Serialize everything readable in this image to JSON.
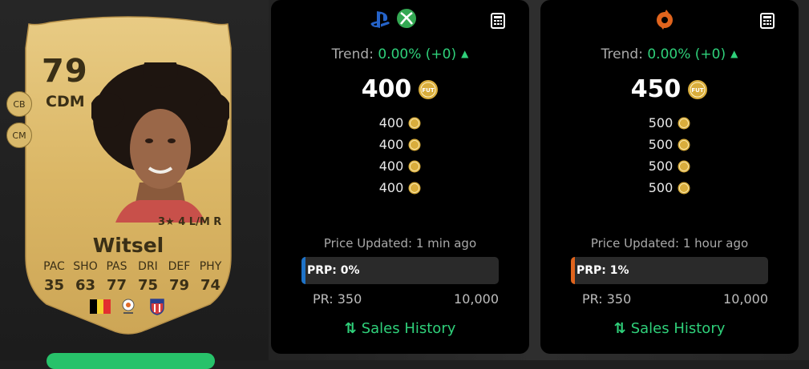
{
  "card": {
    "rating": "79",
    "position": "CDM",
    "alt_positions": [
      "CB",
      "CM"
    ],
    "skills": "3∅4 L/M R",
    "skills_display": "3★ 4 L/M R",
    "name": "Witsel",
    "stat_labels": [
      "PAC",
      "SHO",
      "PAS",
      "DRI",
      "DEF",
      "PHY"
    ],
    "stat_values": [
      "35",
      "63",
      "77",
      "75",
      "79",
      "74"
    ],
    "colors": {
      "gold": "#d8b567",
      "text": "#3a2f16"
    }
  },
  "panels": [
    {
      "platform": "console",
      "icons": [
        "playstation-icon",
        "xbox-icon"
      ],
      "trend_label": "Trend:",
      "trend_value": "0.00% (+0)",
      "main_price": "400",
      "prices": [
        "400",
        "400",
        "400",
        "400"
      ],
      "updated": "Price Updated: 1 min ago",
      "prp_label": "PRP: 0%",
      "prp_fraction": 0,
      "pr_min": "PR: 350",
      "pr_max": "10,000",
      "sales_label": "Sales History",
      "accent": "#1e73c8"
    },
    {
      "platform": "pc",
      "icons": [
        "origin-icon"
      ],
      "trend_label": "Trend:",
      "trend_value": "0.00% (+0)",
      "main_price": "450",
      "prices": [
        "500",
        "500",
        "500",
        "500"
      ],
      "updated": "Price Updated: 1 hour ago",
      "prp_label": "PRP: 1%",
      "prp_fraction": 0.01,
      "pr_min": "PR: 350",
      "pr_max": "10,000",
      "sales_label": "Sales History",
      "accent": "#e0641d"
    }
  ],
  "colors": {
    "trend_green": "#2fd07a",
    "coin_gold": "#d9ad3c"
  }
}
